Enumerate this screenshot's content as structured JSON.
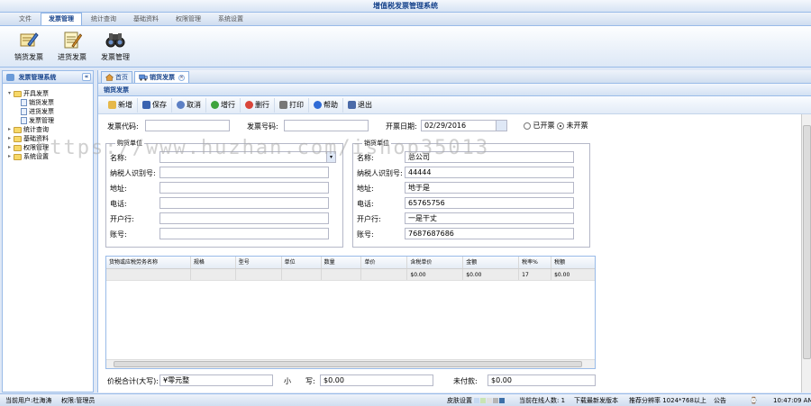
{
  "app": {
    "title": "增值税发票管理系统"
  },
  "menu": {
    "items": [
      {
        "label": "文件",
        "active": false
      },
      {
        "label": "发票管理",
        "active": true
      },
      {
        "label": "统计查询",
        "active": false
      },
      {
        "label": "基础资料",
        "active": false
      },
      {
        "label": "权限管理",
        "active": false
      },
      {
        "label": "系统设置",
        "active": false
      }
    ]
  },
  "ribbon": {
    "buttons": [
      {
        "label": "销货发票",
        "icon": "edit-pen-icon"
      },
      {
        "label": "进货发票",
        "icon": "notepad-pencil-icon"
      },
      {
        "label": "发票管理",
        "icon": "binoculars-icon"
      }
    ]
  },
  "left_panel": {
    "title": "发票管理系统",
    "collapse_glyph": "«",
    "tree": [
      {
        "label": "开具发票",
        "level": 0,
        "type": "folder",
        "expanded": true
      },
      {
        "label": "销货发票",
        "level": 1,
        "type": "item"
      },
      {
        "label": "进货发票",
        "level": 1,
        "type": "item"
      },
      {
        "label": "发票管理",
        "level": 1,
        "type": "item"
      },
      {
        "label": "统计查询",
        "level": 0,
        "type": "folder",
        "expanded": false
      },
      {
        "label": "基础资料",
        "level": 0,
        "type": "folder",
        "expanded": false
      },
      {
        "label": "权限管理",
        "level": 0,
        "type": "folder",
        "expanded": false
      },
      {
        "label": "系统设置",
        "level": 0,
        "type": "folder",
        "expanded": false
      }
    ]
  },
  "tabs": [
    {
      "label": "首页",
      "active": false
    },
    {
      "label": "销货发票",
      "active": true
    }
  ],
  "section_title": "销货发票",
  "toolbar": {
    "buttons": [
      {
        "label": "新增",
        "color": "#e6b84a"
      },
      {
        "label": "保存",
        "color": "#3a63b0"
      },
      {
        "label": "取消",
        "color": "#5c7fc4"
      },
      {
        "label": "增行",
        "color": "#3ea33e"
      },
      {
        "label": "删行",
        "color": "#d9453a"
      },
      {
        "label": "打印",
        "color": "#777777"
      },
      {
        "label": "帮助",
        "color": "#2f6bd6"
      },
      {
        "label": "退出",
        "color": "#4a6aa8"
      }
    ]
  },
  "form": {
    "invoice_code_label": "发票代码:",
    "invoice_code_value": "",
    "invoice_number_label": "发票号码:",
    "invoice_number_value": "",
    "date_label": "开票日期:",
    "date_value": "02/29/2016",
    "radio_issued": "已开票",
    "radio_not_issued": "未开票",
    "selected_radio": "未开票",
    "buyer": {
      "legend": "购货单位",
      "name_label": "名称:",
      "name_value": "",
      "tax_label": "纳税人识别号:",
      "tax_value": "",
      "address_label": "地址:",
      "address_value": "",
      "phone_label": "电话:",
      "phone_value": "",
      "bank_label": "开户行:",
      "bank_value": "",
      "account_label": "账号:",
      "account_value": ""
    },
    "seller": {
      "legend": "销货单位",
      "name_label": "名称:",
      "name_value": "总公司",
      "tax_label": "纳税人识别号:",
      "tax_value": "44444",
      "address_label": "地址:",
      "address_value": "地于是",
      "phone_label": "电话:",
      "phone_value": "65765756",
      "bank_label": "开户行:",
      "bank_value": "一是干丈",
      "account_label": "账号:",
      "account_value": "7687687686"
    }
  },
  "grid": {
    "columns": [
      "货物或应税劳务名称",
      "规格",
      "型号",
      "单位",
      "数量",
      "单价",
      "含税单价",
      "金额",
      "税率%",
      "税额"
    ],
    "rows": [
      [
        "",
        "",
        "",
        "",
        "",
        "",
        "$0.00",
        "$0.00",
        "17",
        "$0.00"
      ]
    ]
  },
  "totals": {
    "total_label": "价税合计(大写):",
    "total_value": "¥零元整",
    "small_label": "小　　写:",
    "small_value": "$0.00",
    "unpaid_label": "未付款:",
    "unpaid_value": "$0.00"
  },
  "status": {
    "user": "当前用户:杜海涛",
    "role": "权限:管理员",
    "skin_label": "皮肤设置",
    "skin_colors": [
      "#c6d9f1",
      "#c9e4b4",
      "#e0e0e0",
      "#b5b5b5",
      "#3d6fa8"
    ],
    "online": "当前在线人数: 1",
    "download": "下载最新发版本",
    "resolution": "推荐分辨率 1024*768以上",
    "notice": "公告",
    "time": "10:47:09 AM"
  },
  "watermark": "https://www.huzhan.com/ishop35013"
}
